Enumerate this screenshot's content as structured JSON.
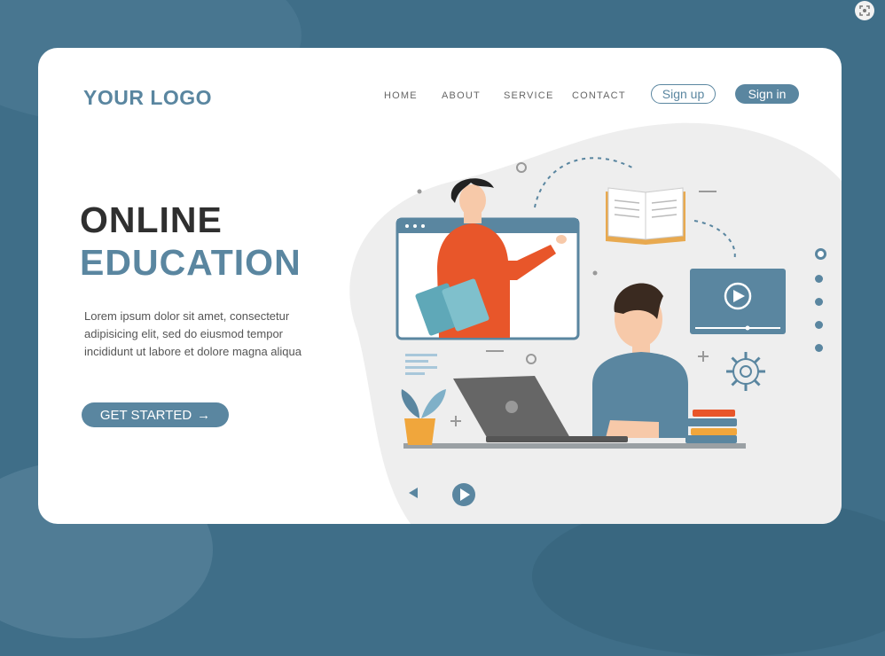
{
  "header": {
    "logo": "YOUR LOGO",
    "nav": [
      "HOME",
      "ABOUT",
      "SERVICE",
      "CONTACT"
    ],
    "signup_label": "Sign up",
    "signin_label": "Sign in"
  },
  "hero": {
    "title_line1": "ONLINE",
    "title_line2": "EDUCATION",
    "description": "Lorem ipsum dolor sit amet, consectetur adipisicing elit, sed do eiusmod tempor incididunt ut labore et dolore magna aliqua",
    "cta_label": "GET STARTED",
    "cta_arrow": "→"
  },
  "colors": {
    "accent": "#5a86a0",
    "background": "#3f6e88",
    "teacher_shirt": "#e8562a",
    "blob": "#eeeeee"
  },
  "icons": [
    "lens-icon",
    "book-icon",
    "video-play-icon",
    "gear-icon",
    "plant-icon",
    "laptop-icon",
    "books-stack-icon"
  ]
}
